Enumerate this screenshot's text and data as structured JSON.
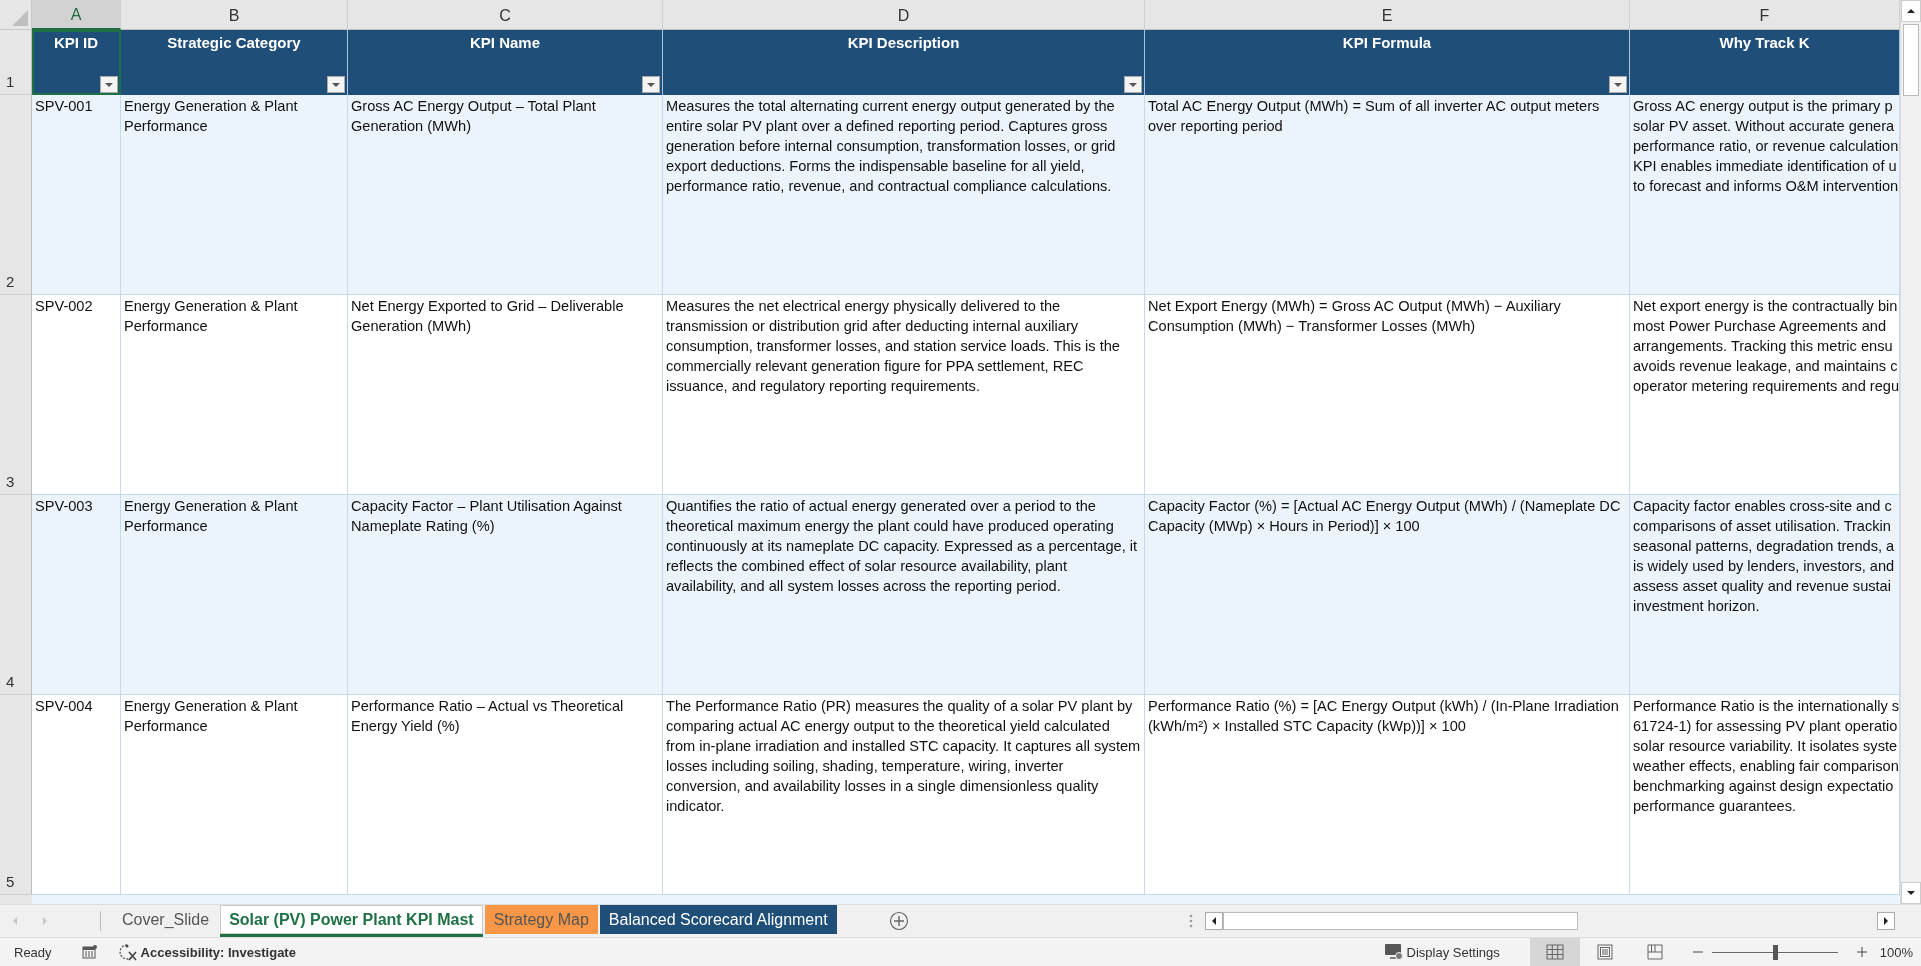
{
  "column_letters": [
    {
      "label": "A",
      "selected": true
    },
    {
      "label": "B",
      "selected": false
    },
    {
      "label": "C",
      "selected": false
    },
    {
      "label": "D",
      "selected": false
    },
    {
      "label": "E",
      "selected": false
    },
    {
      "label": "F",
      "selected": false
    }
  ],
  "header_row": {
    "row_number": "1",
    "cells": [
      {
        "text": "KPI ID",
        "filter": true,
        "selected": true
      },
      {
        "text": "Strategic Category",
        "filter": true,
        "selected": false
      },
      {
        "text": "KPI Name",
        "filter": true,
        "selected": false
      },
      {
        "text": "KPI Description",
        "filter": true,
        "selected": false
      },
      {
        "text": "KPI Formula",
        "filter": true,
        "selected": false
      },
      {
        "text": "Why Track K",
        "filter": false,
        "selected": false
      }
    ]
  },
  "rows": [
    {
      "row_number": "2",
      "cells": [
        "SPV-001",
        "Energy Generation & Plant Performance",
        "Gross AC Energy Output – Total Plant Generation (MWh)",
        "Measures the total alternating current energy output generated by the entire solar PV plant over a defined reporting period. Captures gross generation before internal consumption, transformation losses, or grid export deductions. Forms the indispensable baseline for all yield, performance ratio, revenue, and contractual compliance calculations.",
        "Total AC Energy Output (MWh) = Sum of all inverter AC output meters over reporting period",
        "Gross AC energy output is the primary p\nsolar PV asset. Without accurate genera\nperformance ratio, or revenue calculation\nKPI enables immediate identification of u\nto forecast and informs O&M intervention"
      ]
    },
    {
      "row_number": "3",
      "cells": [
        "SPV-002",
        "Energy Generation & Plant Performance",
        "Net Energy Exported to Grid – Deliverable Generation (MWh)",
        "Measures the net electrical energy physically delivered to the transmission or distribution grid after deducting internal auxiliary consumption, transformer losses, and station service loads. This is the commercially relevant generation figure for PPA settlement, REC issuance, and regulatory reporting requirements.",
        "Net Export Energy (MWh) = Gross AC Output (MWh) − Auxiliary Consumption (MWh) − Transformer Losses (MWh)",
        "Net export energy is the contractually bin\nmost Power Purchase Agreements and\narrangements. Tracking this metric ensu\navoids revenue leakage, and maintains c\noperator metering requirements and regu"
      ]
    },
    {
      "row_number": "4",
      "cells": [
        "SPV-003",
        "Energy Generation & Plant Performance",
        "Capacity Factor – Plant Utilisation Against Nameplate Rating (%)",
        "Quantifies the ratio of actual energy generated over a period to the theoretical maximum energy the plant could have produced operating continuously at its nameplate DC capacity. Expressed as a percentage, it reflects the combined effect of solar resource availability, plant availability, and all system losses across the reporting period.",
        "Capacity Factor (%) = [Actual AC Energy Output (MWh) / (Nameplate DC Capacity (MWp) × Hours in Period)] × 100",
        "Capacity factor enables cross-site and c\ncomparisons of asset utilisation. Trackin\nseasonal patterns, degradation trends, a\nis widely used by lenders, investors, and\nassess asset quality and revenue sustai\ninvestment horizon."
      ]
    },
    {
      "row_number": "5",
      "cells": [
        "SPV-004",
        "Energy Generation & Plant Performance",
        "Performance Ratio – Actual vs Theoretical Energy Yield (%)",
        "The Performance Ratio (PR) measures the quality of a solar PV plant by comparing actual AC energy output to the theoretical yield calculated from in-plane irradiation and installed STC capacity. It captures all system losses including soiling, shading, temperature, wiring, inverter conversion, and availability losses in a single dimensionless quality indicator.",
        "Performance Ratio (%) = [AC Energy Output (kWh) / (In-Plane Irradiation (kWh/m²) × Installed STC Capacity (kWp))] × 100",
        "Performance Ratio is the internationally s\n61724-1) for assessing PV plant operatio\nsolar resource variability. It isolates syste\nweather effects, enabling fair comparison\nbenchmarking against design expectatio\nperformance guarantees."
      ]
    }
  ],
  "sheet_tabs": [
    {
      "label": "Cover_Slide",
      "selected": false,
      "color": "#f0f0f0"
    },
    {
      "label": "Solar (PV) Power Plant KPI Mast",
      "selected": true,
      "color": "#ffffff"
    },
    {
      "label": "Strategy Map",
      "selected": false,
      "color": "#f79646"
    },
    {
      "label": "Balanced Scorecard Alignment",
      "selected": false,
      "color": "#1f4e79"
    }
  ],
  "status_bar": {
    "mode": "Ready",
    "accessibility": "Accessibility: Investigate",
    "display_settings": "Display Settings",
    "views": [
      {
        "kind": "normal",
        "selected": true
      },
      {
        "kind": "page-layout",
        "selected": false
      },
      {
        "kind": "page-break",
        "selected": false
      }
    ],
    "zoom": {
      "level": 0.5,
      "reading": "100%"
    }
  }
}
